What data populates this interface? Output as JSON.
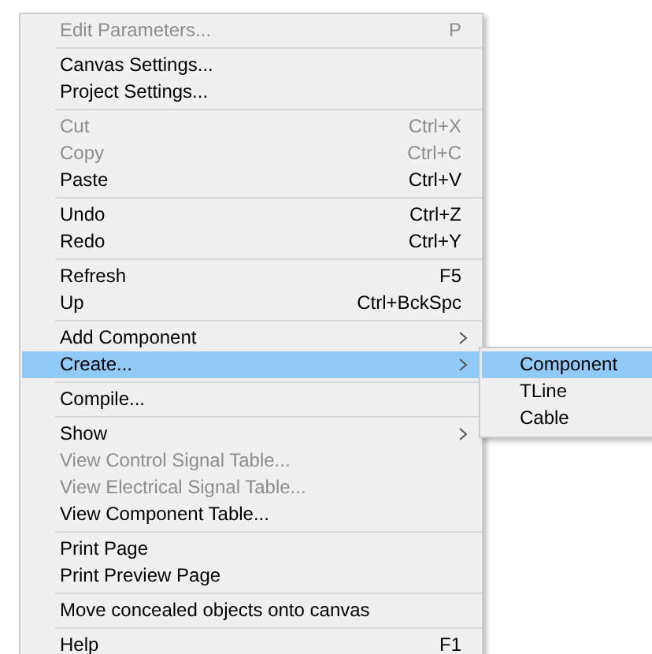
{
  "menu": {
    "items": [
      {
        "kind": "item",
        "label": "Edit Parameters...",
        "shortcut": "P",
        "disabled": true,
        "submenu": false,
        "selected": false
      },
      {
        "kind": "separator"
      },
      {
        "kind": "item",
        "label": "Canvas Settings...",
        "disabled": false,
        "submenu": false,
        "selected": false
      },
      {
        "kind": "item",
        "label": "Project Settings...",
        "disabled": false,
        "submenu": false,
        "selected": false
      },
      {
        "kind": "separator"
      },
      {
        "kind": "item",
        "label": "Cut",
        "shortcut": "Ctrl+X",
        "disabled": true,
        "submenu": false,
        "selected": false
      },
      {
        "kind": "item",
        "label": "Copy",
        "shortcut": "Ctrl+C",
        "disabled": true,
        "submenu": false,
        "selected": false
      },
      {
        "kind": "item",
        "label": "Paste",
        "shortcut": "Ctrl+V",
        "disabled": false,
        "submenu": false,
        "selected": false
      },
      {
        "kind": "separator"
      },
      {
        "kind": "item",
        "label": "Undo",
        "shortcut": "Ctrl+Z",
        "disabled": false,
        "submenu": false,
        "selected": false
      },
      {
        "kind": "item",
        "label": "Redo",
        "shortcut": "Ctrl+Y",
        "disabled": false,
        "submenu": false,
        "selected": false
      },
      {
        "kind": "separator"
      },
      {
        "kind": "item",
        "label": "Refresh",
        "shortcut": "F5",
        "disabled": false,
        "submenu": false,
        "selected": false
      },
      {
        "kind": "item",
        "label": "Up",
        "shortcut": "Ctrl+BckSpc",
        "disabled": false,
        "submenu": false,
        "selected": false
      },
      {
        "kind": "separator"
      },
      {
        "kind": "item",
        "label": "Add Component",
        "disabled": false,
        "submenu": true,
        "selected": false
      },
      {
        "kind": "item",
        "label": "Create...",
        "disabled": false,
        "submenu": true,
        "selected": true
      },
      {
        "kind": "separator"
      },
      {
        "kind": "item",
        "label": "Compile...",
        "disabled": false,
        "submenu": false,
        "selected": false
      },
      {
        "kind": "separator"
      },
      {
        "kind": "item",
        "label": "Show",
        "disabled": false,
        "submenu": true,
        "selected": false
      },
      {
        "kind": "item",
        "label": "View Control Signal Table...",
        "disabled": true,
        "submenu": false,
        "selected": false
      },
      {
        "kind": "item",
        "label": "View Electrical Signal Table...",
        "disabled": true,
        "submenu": false,
        "selected": false
      },
      {
        "kind": "item",
        "label": "View Component Table...",
        "disabled": false,
        "submenu": false,
        "selected": false
      },
      {
        "kind": "separator"
      },
      {
        "kind": "item",
        "label": "Print Page",
        "disabled": false,
        "submenu": false,
        "selected": false
      },
      {
        "kind": "item",
        "label": "Print Preview Page",
        "disabled": false,
        "submenu": false,
        "selected": false
      },
      {
        "kind": "separator"
      },
      {
        "kind": "item",
        "label": "Move concealed objects onto canvas",
        "disabled": false,
        "submenu": false,
        "selected": false
      },
      {
        "kind": "separator"
      },
      {
        "kind": "item",
        "label": "Help",
        "shortcut": "F1",
        "disabled": false,
        "submenu": false,
        "selected": false
      }
    ]
  },
  "submenu": {
    "items": [
      {
        "label": "Component",
        "selected": true
      },
      {
        "label": "TLine",
        "selected": false
      },
      {
        "label": "Cable",
        "selected": false
      }
    ]
  }
}
